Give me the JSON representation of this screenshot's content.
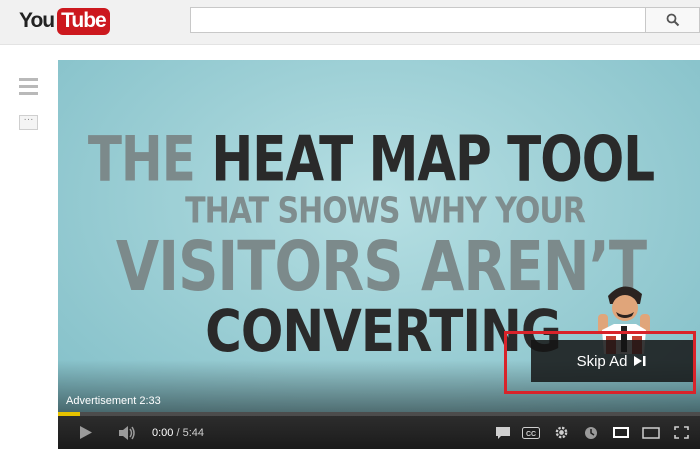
{
  "header": {
    "logo_you": "You",
    "logo_tube": "Tube",
    "search_placeholder": ""
  },
  "video": {
    "line1_a": "THE ",
    "line1_b": "HEAT MAP TOOL",
    "line2": "THAT SHOWS WHY YOUR",
    "line3": "VISITORS AREN’T",
    "line4": "CONVERTING",
    "advertisement_label": "Advertisement 2:33",
    "skip_ad_label": "Skip Ad",
    "progress_fraction": 0.035
  },
  "controls": {
    "current_time": "0:00",
    "separator": " / ",
    "duration": "5:44"
  },
  "colors": {
    "highlight": "#d9232a",
    "progress": "#e6c200",
    "brand_red": "#cc181e"
  }
}
